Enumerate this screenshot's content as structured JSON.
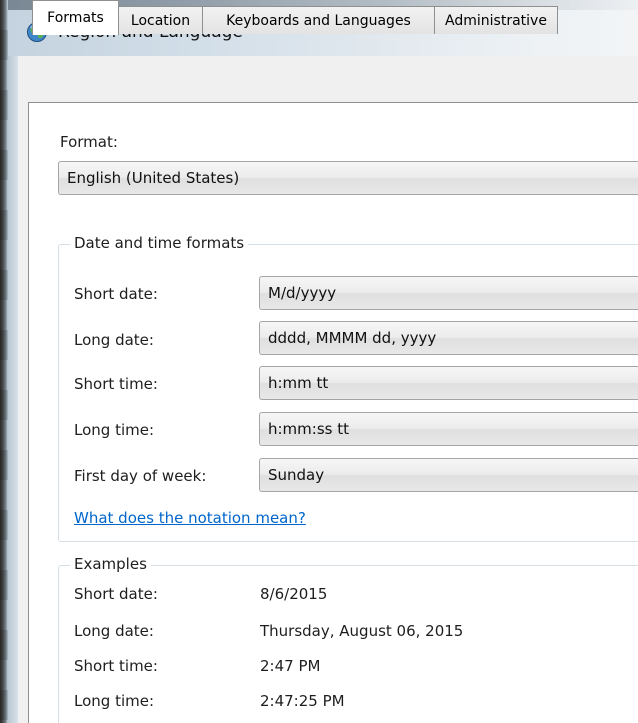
{
  "window": {
    "title": "Region and Language"
  },
  "tabs": [
    {
      "label": "Formats",
      "active": true
    },
    {
      "label": "Location",
      "active": false
    },
    {
      "label": "Keyboards and Languages",
      "active": false
    },
    {
      "label": "Administrative",
      "active": false
    }
  ],
  "format": {
    "label": "Format:",
    "selected": "English (United States)"
  },
  "date_time_formats": {
    "title": "Date and time formats",
    "short_date": {
      "label": "Short date:",
      "value": "M/d/yyyy"
    },
    "long_date": {
      "label": "Long date:",
      "value": "dddd, MMMM dd, yyyy"
    },
    "short_time": {
      "label": "Short time:",
      "value": "h:mm tt"
    },
    "long_time": {
      "label": "Long time:",
      "value": "h:mm:ss tt"
    },
    "first_day": {
      "label": "First day of week:",
      "value": "Sunday"
    },
    "help_link": "What does the notation mean?"
  },
  "examples": {
    "title": "Examples",
    "short_date": {
      "label": "Short date:",
      "value": "8/6/2015"
    },
    "long_date": {
      "label": "Long date:",
      "value": "Thursday, August 06, 2015"
    },
    "short_time": {
      "label": "Short time:",
      "value": "2:47 PM"
    },
    "long_time": {
      "label": "Long time:",
      "value": "2:47:25 PM"
    }
  },
  "colors": {
    "link": "#0066cc",
    "tab_border": "#8e8f8f",
    "group_border": "#d5dfe5"
  }
}
